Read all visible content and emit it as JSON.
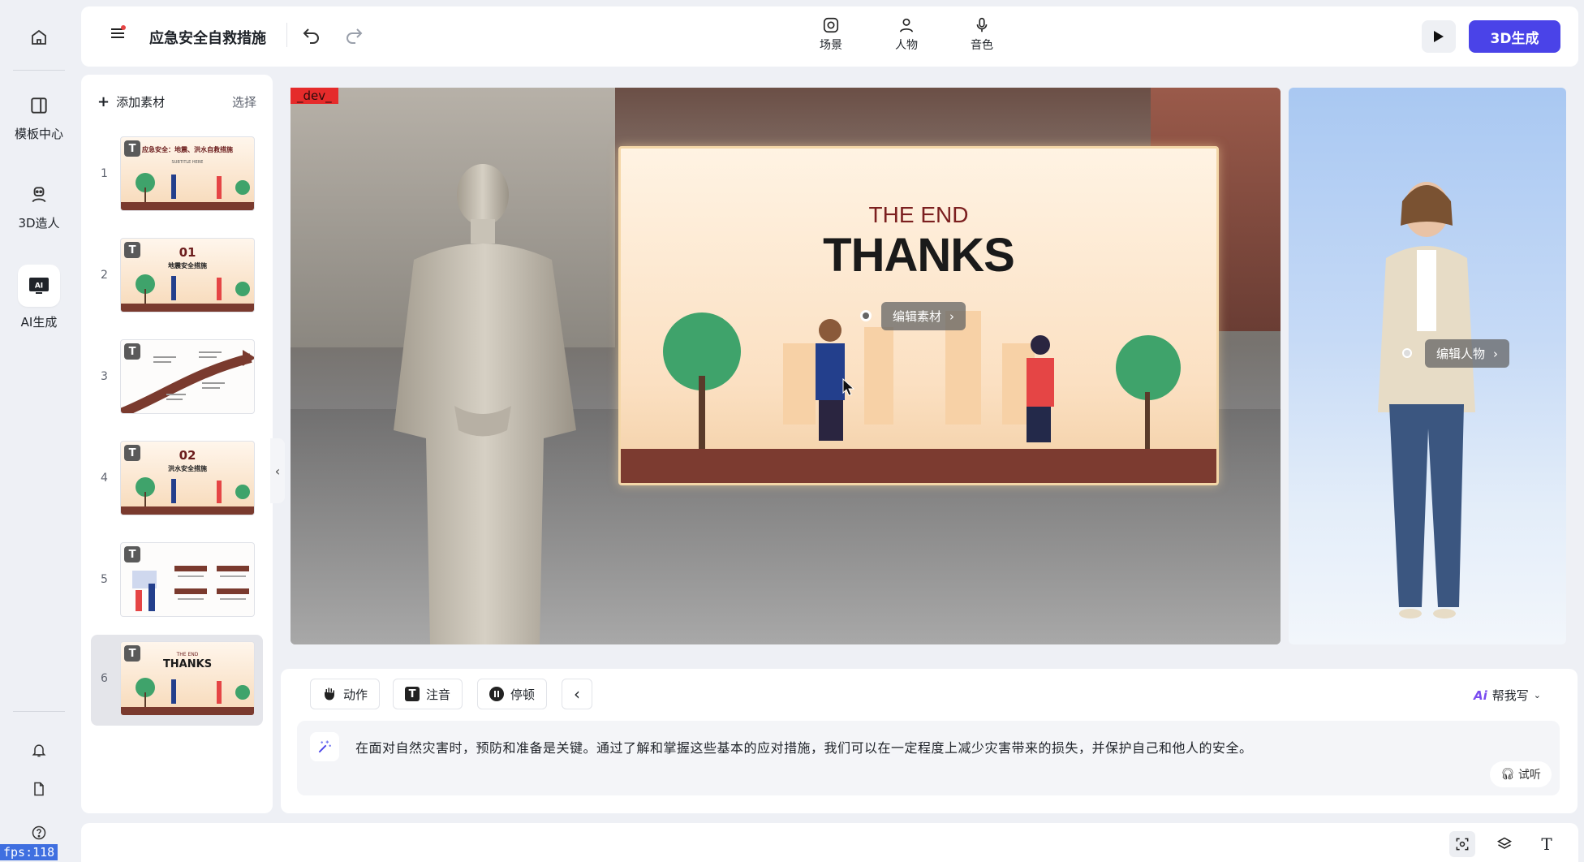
{
  "rail": {
    "template_label": "模板中心",
    "avatar3d_label": "3D造人",
    "ai_label": "AI生成"
  },
  "fps": "fps:118",
  "topbar": {
    "title": "应急安全自救措施",
    "tools": [
      "场景",
      "人物",
      "音色"
    ],
    "generate_label": "3D生成"
  },
  "slides": {
    "add_label": "添加素材",
    "select_label": "选择",
    "items": [
      {
        "num": "1",
        "badge": "T",
        "title": "应急安全：地震、洪水自救措施",
        "sub": "SUBTITLE HERE"
      },
      {
        "num": "2",
        "badge": "T",
        "title": "01",
        "sub": "地震安全措施"
      },
      {
        "num": "3",
        "badge": "T",
        "title": "",
        "sub": ""
      },
      {
        "num": "4",
        "badge": "T",
        "title": "02",
        "sub": "洪水安全措施"
      },
      {
        "num": "5",
        "badge": "T",
        "title": "",
        "sub": ""
      },
      {
        "num": "6",
        "badge": "T",
        "title": "THANKS",
        "sub": "THE END"
      }
    ]
  },
  "canvas": {
    "dev_tag": "_dev_",
    "card_sub": "THE END",
    "card_title": "THANKS",
    "edit_material_label": "编辑素材",
    "edit_person_label": "编辑人物"
  },
  "script": {
    "action_label": "动作",
    "phonetic_label": "注音",
    "pause_label": "停顿",
    "help_write_label": "帮我写",
    "text": "在面对自然灾害时，预防和准备是关键。通过了解和掌握这些基本的应对措施，我们可以在一定程度上减少灾害带来的损失，并保护自己和他人的安全。",
    "listen_label": "试听"
  },
  "colors": {
    "accent": "#4a43e8",
    "card_title_red": "#7b1f1f",
    "ground_brown": "#7c3b30"
  }
}
